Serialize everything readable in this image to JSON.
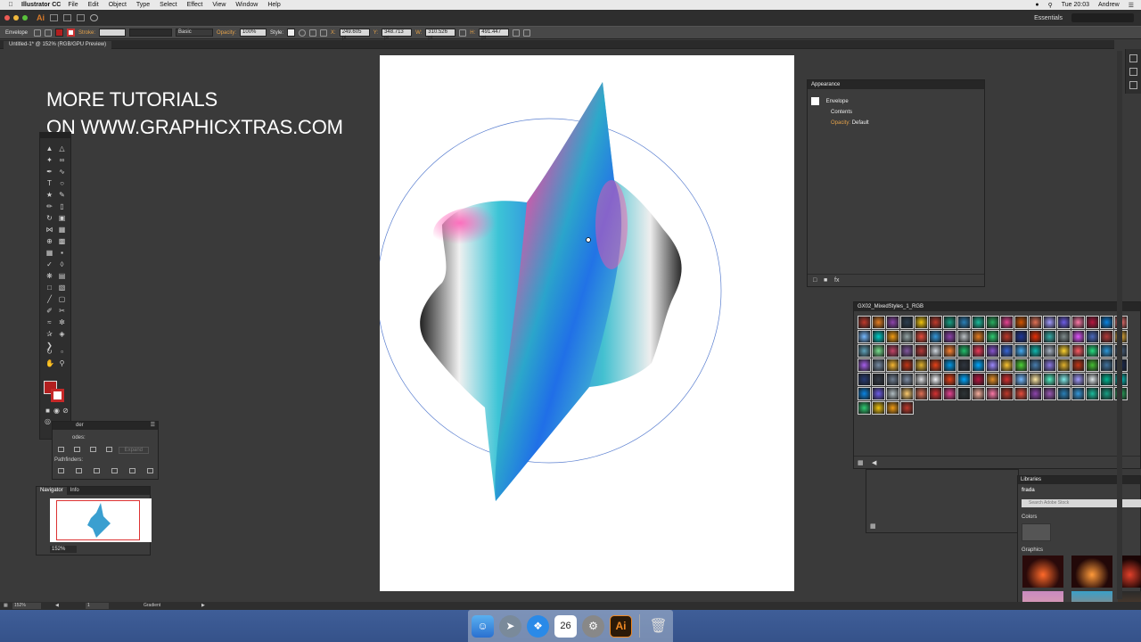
{
  "menubar": {
    "app_name": "Illustrator CC",
    "menus": [
      "File",
      "Edit",
      "Object",
      "Type",
      "Select",
      "Effect",
      "View",
      "Window",
      "Help"
    ],
    "clock": "Tue 20:03",
    "user": "Andrew"
  },
  "appbar": {
    "logo": "Ai",
    "workspace": "Essentials"
  },
  "controlbar": {
    "selection_label": "Envelope",
    "stroke_label": "Stroke:",
    "brush_label": "Basic",
    "opacity_label": "Opacity:",
    "opacity_value": "100%",
    "style_label": "Style:",
    "x_label": "X:",
    "x_value": "249.605 pt",
    "y_label": "Y:",
    "y_value": "348.713 pt",
    "w_label": "W:",
    "w_value": "310.526 pt",
    "h_label": "H:",
    "h_value": "491.447 pt"
  },
  "document": {
    "tab_title": "Untitled-1* @ 152% (RGB/GPU Preview)"
  },
  "promo": {
    "line1": "MORE TUTORIALS",
    "line2": "ON WWW.GRAPHICXTRAS.COM"
  },
  "pathfinder": {
    "title": "der",
    "shape_modes": "odes:",
    "pathfinders": "Pathfinders:",
    "expand": "Expand"
  },
  "navigator": {
    "tab_active": "Navigator",
    "tab_other": "Info",
    "zoom": "152%"
  },
  "appearance": {
    "title": "Appearance",
    "row1": "Envelope",
    "row2": "Contents",
    "opacity_label": "Opacity:",
    "opacity_value": "Default"
  },
  "styles": {
    "title": "GX02_MixedStyles_1_RGB",
    "swatch_colors": [
      "#c0392b",
      "#e67e22",
      "#8e44ad",
      "#2c3e50",
      "#f1c40f",
      "#c0392b",
      "#16a085",
      "#2980b9",
      "#1abc9c",
      "#27ae60",
      "#e84393",
      "#d35400",
      "#e17055",
      "#a29bfe",
      "#6c5ce7",
      "#fd79a8",
      "#b71540",
      "#0984e3",
      "#ff7675",
      "#74b9ff",
      "#00cec9",
      "#f39c12",
      "#95a5a6",
      "#e74c3c",
      "#3498db",
      "#8e44ad",
      "#bdc3c7",
      "#e67e22",
      "#2ecc71",
      "#c0392b",
      "#1e3799",
      "#eb2f06",
      "#38ada9",
      "#7f8c8d",
      "#e056fd",
      "#4a69bd",
      "#b33939",
      "#f6b93b",
      "#60a3bc",
      "#78e08f",
      "#c44569",
      "#82589f",
      "#b33939",
      "#d1d8e0",
      "#fa8231",
      "#20bf6b",
      "#eb3b5a",
      "#8854d0",
      "#3867d6",
      "#45aaf2",
      "#0fb9b1",
      "#a5b1c2",
      "#fed330",
      "#fc5c65",
      "#26de81",
      "#2d98da",
      "#4b6584",
      "#a55eea",
      "#778ca3",
      "#f7b731",
      "#c23616",
      "#e1b12c",
      "#e84118",
      "#0097e6",
      "#2f3640",
      "#00a8ff",
      "#9c88ff",
      "#fbc531",
      "#4cd137",
      "#487eb0",
      "#8c7ae6",
      "#e1b12c",
      "#c23616",
      "#44bd32",
      "#40739e",
      "#192a56",
      "#273c75",
      "#353b48",
      "#718093",
      "#7f8fa6",
      "#dcdde1",
      "#f5f6fa",
      "#e84118",
      "#00a8ff",
      "#b71540",
      "#e58e26",
      "#d63031",
      "#74b9ff",
      "#ffeaa7",
      "#55efc4",
      "#81ecec",
      "#a29bfe",
      "#dfe6e9",
      "#00b894",
      "#00cec9",
      "#0984e3",
      "#6c5ce7",
      "#b2bec3",
      "#fdcb6e",
      "#e17055",
      "#d63031",
      "#e84393",
      "#2d3436",
      "#fab1a0",
      "#fd79a8",
      "#c0392b",
      "#e74c3c",
      "#8e44ad",
      "#9b59b6",
      "#2980b9",
      "#3498db",
      "#1abc9c",
      "#16a085",
      "#27ae60",
      "#2ecc71",
      "#f1c40f",
      "#f39c12",
      "#c0392b"
    ],
    "footer_icon": "styles-library-icon"
  },
  "libraries": {
    "title": "Libraries",
    "library_name": "frada",
    "search_placeholder": "Search Adobe Stock",
    "colors_label": "Colors",
    "graphics_label": "Graphics"
  },
  "statusbar": {
    "zoom": "152%",
    "page": "1",
    "tool": "Gradient"
  },
  "dock": {
    "calendar_day": "26",
    "ai_label": "Ai"
  }
}
